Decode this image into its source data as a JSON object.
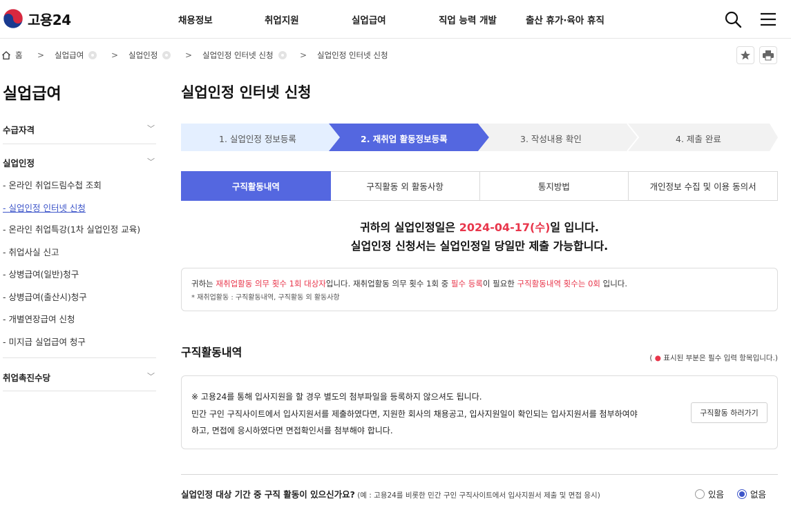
{
  "header": {
    "logo_text": "고용24",
    "nav": [
      "채용정보",
      "취업지원",
      "실업급여",
      "직업 능력 개발",
      "출산 휴가·육아 휴직"
    ]
  },
  "breadcrumb": {
    "home": "홈",
    "items": [
      "실업급여",
      "실업인정",
      "실업인정 인터넷 신청",
      "실업인정 인터넷 신청"
    ]
  },
  "sidebar": {
    "title": "실업급여",
    "groups": [
      "수급자격",
      "실업인정",
      "취업촉진수당"
    ],
    "sub_items": [
      "- 온라인 취업드림수첩 조회",
      "- 실업인정 인터넷 신청",
      "- 온라인 취업특강(1차 실업인정 교육)",
      "- 취업사실 신고",
      "- 상병급여(일반)청구",
      "- 상병급여(출산시)청구",
      "- 개별연장급여 신청",
      "- 미지급 실업급여 청구"
    ],
    "active_index": 1
  },
  "main": {
    "title": "실업인정 인터넷 신청",
    "steps": [
      "1. 실업인정 정보등록",
      "2. 재취업 활동정보등록",
      "3. 작성내용 확인",
      "4. 제출 완료"
    ],
    "active_step": 1,
    "tabs": [
      "구직활동내역",
      "구직활동 외 활동사항",
      "통지방법",
      "개인정보 수집 및 이용 동의서"
    ],
    "active_tab": 0,
    "notice": {
      "line1_pre": "귀하의 실업인정일은 ",
      "date": "2024-04-17(수)",
      "line1_post": "일 입니다.",
      "line2": "실업인정 신청서는 실업인정일 당일만 제출 가능합니다."
    },
    "info": {
      "p1": "귀하는 ",
      "r1": "재취업활동 의무 횟수 1회 대상자",
      "p2": "입니다. 재취업활동 의무 횟수 1회 중 ",
      "r2": "필수 등록",
      "p3": "이 필요한 ",
      "r3": "구직활동내역 횟수는 0회",
      "p4": " 입니다.",
      "sub": "* 재취업활동 : 구직활동내역, 구직활동 외 활동사항"
    },
    "section_title": "구직활동내역",
    "required_note": {
      "open": "( ",
      "bullet": "●",
      "text": " 표시된 부분은 필수 입력 항목입니다.)"
    },
    "guide": {
      "line1": "※ 고용24를 통해 입사지원을 할 경우 별도의 첨부파일을 등록하지 않으셔도 됩니다.",
      "line2": "민간 구인 구직사이트에서 입사지원서를 제출하였다면, 지원한 회사의 채용공고, 입사지원일이 확인되는 입사지원서를 첨부하여야",
      "line3": "하고, 면접에 응시하였다면 면접확인서를 첨부해야 합니다.",
      "button": "구직활동 하러가기"
    },
    "question": {
      "label": "실업인정 대상 기간 중 구직 활동이 있으신가요?",
      "hint": " (예 : 고용24를 비롯한 민간 구인 구직사이트에서 입사지원서 제출 및 면접 응시)",
      "options": [
        "있음",
        "없음"
      ],
      "selected": 1
    }
  },
  "colors": {
    "primary": "#5467e0",
    "accent_red": "#e8364b",
    "step_done": "#e4efff",
    "step_todo": "#f2f2f2"
  }
}
